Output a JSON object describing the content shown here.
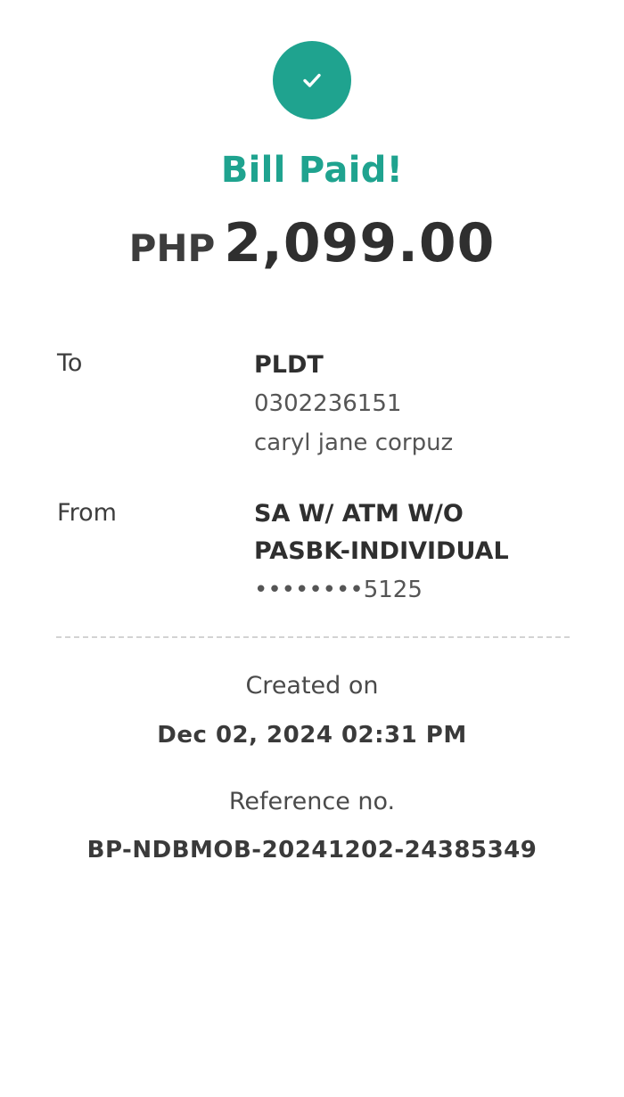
{
  "status": {
    "icon": "check-icon",
    "color": "#1fa38f",
    "title": "Bill Paid!"
  },
  "amount": {
    "currency": "PHP",
    "value": "2,099.00"
  },
  "to": {
    "label": "To",
    "biller": "PLDT",
    "account_number": "0302236151",
    "account_name": "caryl jane corpuz"
  },
  "from": {
    "label": "From",
    "account_type_line1": "SA W/ ATM W/O",
    "account_type_line2": "PASBK-INDIVIDUAL",
    "masked_account": "••••••••5125"
  },
  "created": {
    "label": "Created on",
    "value": "Dec 02, 2024 02:31 PM"
  },
  "reference": {
    "label": "Reference no.",
    "value": "BP-NDBMOB-20241202-24385349"
  }
}
